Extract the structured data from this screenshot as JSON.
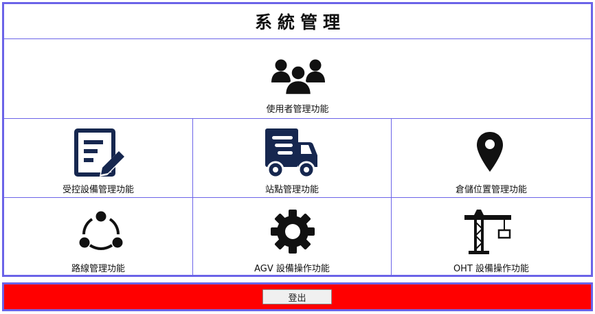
{
  "header": {
    "title": "系統管理"
  },
  "menu": {
    "user_management": {
      "label": "使用者管理功能",
      "icon": "users-group-icon"
    },
    "equipment_control": {
      "label": "受控設備管理功能",
      "icon": "edit-document-icon"
    },
    "station": {
      "label": "站點管理功能",
      "icon": "delivery-truck-icon"
    },
    "storage_location": {
      "label": "倉儲位置管理功能",
      "icon": "map-pin-icon"
    },
    "route": {
      "label": "路線管理功能",
      "icon": "route-nodes-icon"
    },
    "agv": {
      "label": "AGV 設備操作功能",
      "icon": "gear-icon"
    },
    "oht": {
      "label": "OHT 設備操作功能",
      "icon": "crane-icon"
    }
  },
  "footer": {
    "logout_label": "登出",
    "bar_color": "#ff0000"
  },
  "colors": {
    "border": "#6b63e8",
    "icon_dark": "#111111",
    "icon_navy": "#16274f"
  }
}
